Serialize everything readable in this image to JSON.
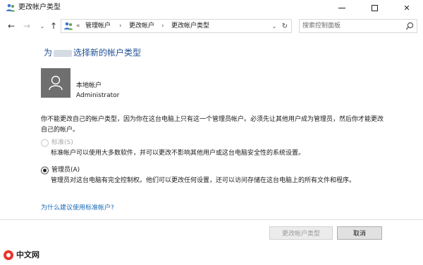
{
  "window": {
    "title": "更改帐户类型"
  },
  "nav": {
    "breadcrumb_chevron": "«",
    "breadcrumbs": [
      "管理帐户",
      "更改帐户",
      "更改帐户类型"
    ],
    "separator": "›"
  },
  "search": {
    "placeholder": "搜索控制面板"
  },
  "main": {
    "heading_prefix": "为",
    "heading_suffix": "选择新的帐户类型",
    "account": {
      "type": "本地帐户",
      "name": "Administrator"
    },
    "warning": "你不能更改自己的帐户类型，因为你在这台电脑上只有这一个管理员帐户。必须先让其他用户成为管理员，然后你才能更改自己的帐户。",
    "options": {
      "standard": {
        "label": "标准(S)",
        "description": "标准帐户可以使用大多数软件，并可以更改不影响其他用户或这台电脑安全性的系统设置。",
        "selected": false,
        "enabled": false
      },
      "admin": {
        "label": "管理员(A)",
        "description": "管理员对这台电脑有完全控制权。他们可以更改任何设置，还可以访问存储在这台电脑上的所有文件和程序。",
        "selected": true,
        "enabled": true
      }
    },
    "help_link": "为什么建议使用标准帐户?"
  },
  "buttons": {
    "change_label": "更改帐户类型",
    "cancel_label": "取消"
  },
  "watermark": {
    "text": "中文网"
  },
  "colors": {
    "heading": "#1f4f94",
    "link": "#1a6ab5",
    "avatar_bg": "#6f6f6f"
  }
}
